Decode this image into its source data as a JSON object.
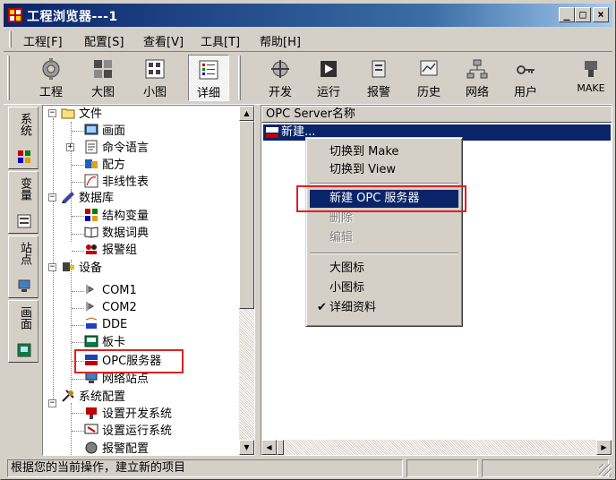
{
  "window": {
    "title": "工程浏览器---1",
    "buttons": [
      "_",
      "□",
      "×"
    ]
  },
  "menubar": {
    "items": [
      {
        "label": "工程[F]"
      },
      {
        "label": "配置[S]"
      },
      {
        "label": "查看[V]"
      },
      {
        "label": "工具[T]"
      },
      {
        "label": "帮助[H]"
      }
    ]
  },
  "toolbar": {
    "group1": [
      {
        "label": "工程",
        "icon": "project-icon"
      },
      {
        "label": "大图",
        "icon": "large-icons-icon"
      },
      {
        "label": "小图",
        "icon": "small-icons-icon"
      },
      {
        "label": "详细",
        "icon": "details-icon",
        "pressed": true
      }
    ],
    "group2": [
      {
        "label": "开发",
        "icon": "develop-icon"
      },
      {
        "label": "运行",
        "icon": "run-icon"
      },
      {
        "label": "报警",
        "icon": "alarm-icon"
      },
      {
        "label": "历史",
        "icon": "history-icon"
      },
      {
        "label": "网络",
        "icon": "network-icon"
      },
      {
        "label": "用户",
        "icon": "user-icon"
      },
      {
        "label": "MAKE",
        "icon": "make-icon"
      }
    ]
  },
  "side_tabs": [
    {
      "label": "系统"
    },
    {
      "label": "变量"
    },
    {
      "label": "站点"
    },
    {
      "label": "画面"
    }
  ],
  "tree": {
    "nodes": [
      {
        "label": "文件",
        "icon": "folder-icon"
      },
      {
        "label": "画面",
        "icon": "screen-icon"
      },
      {
        "label": "命令语言",
        "icon": "command-icon"
      },
      {
        "label": "配方",
        "icon": "recipe-icon"
      },
      {
        "label": "非线性表",
        "icon": "nonlinear-table-icon"
      },
      {
        "label": "数据库",
        "icon": "database-icon"
      },
      {
        "label": "结构变量",
        "icon": "struct-variable-icon"
      },
      {
        "label": "数据词典",
        "icon": "data-dictionary-icon"
      },
      {
        "label": "报警组",
        "icon": "alarm-group-icon"
      },
      {
        "label": "设备",
        "icon": "device-icon"
      },
      {
        "label": "COM1",
        "icon": "com-port-icon"
      },
      {
        "label": "COM2",
        "icon": "com-port-icon"
      },
      {
        "label": "DDE",
        "icon": "dde-icon"
      },
      {
        "label": "板卡",
        "icon": "board-card-icon"
      },
      {
        "label": "OPC服务器",
        "icon": "opc-icon"
      },
      {
        "label": "网络站点",
        "icon": "network-station-icon"
      },
      {
        "label": "系统配置",
        "icon": "system-config-icon"
      },
      {
        "label": "设置开发系统",
        "icon": "dev-settings-icon"
      },
      {
        "label": "设置运行系统",
        "icon": "run-settings-icon"
      },
      {
        "label": "报警配置",
        "icon": "alarm-config-icon"
      }
    ]
  },
  "list": {
    "column_header": "OPC Server名称",
    "rows": [
      {
        "label": "新建...",
        "icon": "opc-icon",
        "selected": true
      }
    ]
  },
  "context_menu": {
    "items": [
      {
        "label": "切换到 Make",
        "enabled": true
      },
      {
        "label": "切换到 View",
        "enabled": true
      },
      {
        "separator": true
      },
      {
        "label": "新建  OPC 服务器",
        "enabled": true,
        "active": true
      },
      {
        "label": "删除",
        "enabled": false
      },
      {
        "label": "编辑",
        "enabled": false
      },
      {
        "separator": true
      },
      {
        "label": "大图标",
        "enabled": true
      },
      {
        "label": "小图标",
        "enabled": true
      },
      {
        "label": "详细资料",
        "enabled": true,
        "checked": true
      }
    ],
    "check_glyph": "✔"
  },
  "statusbar": {
    "message": "根据您的当前操作，建立新的项目"
  },
  "colors": {
    "title_gradient_start": "#0a246a",
    "title_gradient_end": "#a6caf0",
    "selection": "#0a246a",
    "face": "#d4d0c8",
    "highlight_box": "#e02020"
  }
}
